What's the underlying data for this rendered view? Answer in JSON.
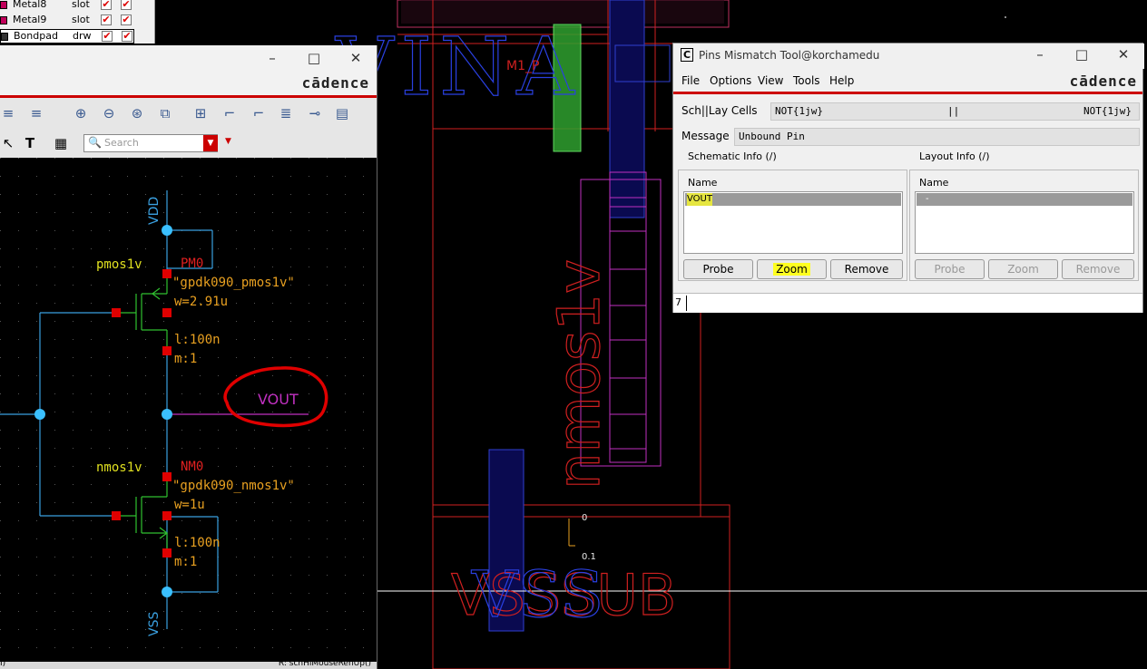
{
  "layers": [
    {
      "name": "Metal8",
      "purpose": "slot",
      "v": "✔",
      "s": "✔"
    },
    {
      "name": "Metal9",
      "purpose": "slot",
      "v": "✔",
      "s": "✔"
    },
    {
      "name": "Bondpad",
      "purpose": "drw",
      "v": "✔",
      "s": "✔"
    }
  ],
  "schematic": {
    "brand": "cādence",
    "search_placeholder": "Search",
    "status_left": "I)",
    "status_right": "R: schHiMouseRenUp()",
    "labels": {
      "vdd": "VDD",
      "vss": "VSS",
      "vout": "VOUT",
      "pmos_cell": "pmos1v",
      "pmos_inst": "PM0",
      "pmos_model": "\"gpdk090_pmos1v\"",
      "pmos_w": "w=2.91u",
      "pmos_l": "l:100n",
      "pmos_m": "m:1",
      "nmos_cell": "nmos1v",
      "nmos_inst": "NM0",
      "nmos_model": "\"gpdk090_nmos1v\"",
      "nmos_w": "w=1u",
      "nmos_l": "l:100n",
      "nmos_m": "m:1"
    }
  },
  "layout": {
    "pin_vina": "VINA",
    "m1_label": "M1_P",
    "nmos_text": "nmos1v",
    "sub_text": "VSSSUB",
    "wss_text": "VSS",
    "coord_0": "0",
    "coord_01": "0.1"
  },
  "dialog": {
    "icon": "C",
    "title": "Pins Mismatch Tool@korchamedu",
    "brand": "cādence",
    "menu": [
      "File",
      "Options",
      "View",
      "Tools",
      "Help"
    ],
    "cells_label": "Sch||Lay Cells",
    "sch_cell": "NOT{1jw}",
    "separator": "||",
    "lay_cell": "NOT{1jw}",
    "message_label": "Message",
    "message": "Unbound Pin",
    "schematic_info_label": "Schematic Info (/)",
    "layout_info_label": "Layout Info (/)",
    "sch_list_header": "Name",
    "sch_list_item": "VOUT",
    "lay_list_header": "Name",
    "lay_list_item": "-",
    "buttons_left": [
      "Probe",
      "Zoom",
      "Remove"
    ],
    "buttons_right": [
      "Probe",
      "Zoom",
      "Remove"
    ],
    "cmd_value": "7"
  }
}
